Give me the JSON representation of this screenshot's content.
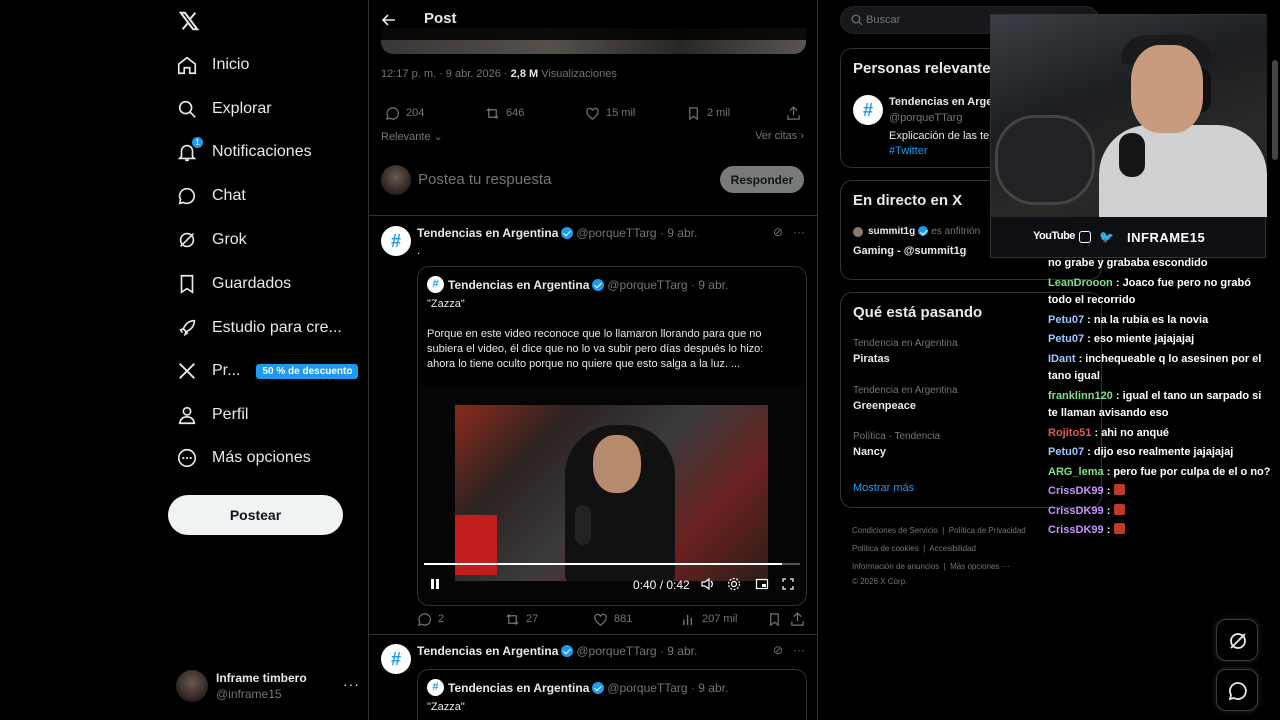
{
  "nav": {
    "items": [
      {
        "label": "Inicio",
        "icon": "home-icon"
      },
      {
        "label": "Explorar",
        "icon": "search-icon"
      },
      {
        "label": "Notificaciones",
        "icon": "bell-icon",
        "badge": "1"
      },
      {
        "label": "Chat",
        "icon": "chat-icon"
      },
      {
        "label": "Grok",
        "icon": "grok-icon"
      },
      {
        "label": "Guardados",
        "icon": "bookmark-icon"
      },
      {
        "label": "Estudio para cre...",
        "icon": "rocket-icon"
      },
      {
        "label": "Pr...",
        "icon": "x-icon",
        "promo": "50 % de descuento"
      },
      {
        "label": "Perfil",
        "icon": "person-icon"
      },
      {
        "label": "Más opciones",
        "icon": "more-circle-icon"
      }
    ],
    "post_button": "Postear",
    "account": {
      "name": "Inframe timbero",
      "handle": "@inframe15",
      "more": "···"
    }
  },
  "main": {
    "title": "Post",
    "post_meta": {
      "time": "12:17 p. m. · 9 abr. 2026 · ",
      "views": "2,8 M",
      "views_label": " Visualizaciones"
    },
    "post_stats": {
      "replies": "204",
      "reposts": "646",
      "likes": "15 mil",
      "bookmarks": "2 mil"
    },
    "sort_label": "Relevante",
    "view_quotes": "Ver citas",
    "reply_placeholder": "Postea tu respuesta",
    "reply_button": "Responder",
    "tweets": [
      {
        "name": "Tendencias en Argentina",
        "handle": "@porqueTTarg · 9 abr.",
        "text": ".",
        "quote": {
          "name": "Tendencias en Argentina",
          "handle": "@porqueTTarg · 9 abr.",
          "title": "\"Zazza\"",
          "body": "Porque en este video reconoce que lo llamaron llorando para que no subiera el video, él dice que no lo va subir pero días después lo hizo: ahora lo tiene oculto porque no quiere que esto salga a la luz.  ...",
          "video_time": "0:40 / 0:42",
          "video_progress": 0.952
        },
        "stats": {
          "replies": "2",
          "reposts": "27",
          "likes": "881",
          "views": "207 mil"
        }
      },
      {
        "name": "Tendencias en Argentina",
        "handle": "@porqueTTarg · 9 abr.",
        "quote": {
          "name": "Tendencias en Argentina",
          "handle": "@porqueTTarg · 9 abr.",
          "title": "\"Zazza\""
        }
      }
    ]
  },
  "right": {
    "search_placeholder": "Buscar",
    "people": {
      "title": "Personas relevantes",
      "name": "Tendencias en Argentina",
      "handle": "@porqueTTarg",
      "bio": "Explicación de las te",
      "tag": "#Twitter"
    },
    "live": {
      "title": "En directo en X",
      "host": "summit1g",
      "host_role": "es anfitrión",
      "stream": "Gaming - @summit1g"
    },
    "trends": {
      "title": "Qué está pasando",
      "items": [
        {
          "context": "Tendencia en Argentina",
          "name": "Piratas"
        },
        {
          "context": "Tendencia en Argentina",
          "name": "Greenpeace"
        },
        {
          "context": "Política · Tendencia",
          "name": "Nancy"
        }
      ],
      "show_more": "Mostrar más"
    },
    "footer": {
      "l1a": "Condiciones de Servicio",
      "l1b": "Política de Privacidad",
      "l2a": "Política de cookies",
      "l2b": "Accesibilidad",
      "l3a": "Información de anuncios",
      "l3b": "Más opciones ···",
      "copyright": "© 2026 X Corp."
    }
  },
  "stream_overlay": {
    "social": {
      "youtube": "YouTube",
      "brand": "INFRAME15"
    },
    "chat": [
      {
        "user": "",
        "color": "#ffffff",
        "text": "no grabe y grababa escondido"
      },
      {
        "user": "LeanDrooon",
        "color": "#7ee08a",
        "text": ": Joaco fue pero no grabó todo el recorrido"
      },
      {
        "user": "Petu07",
        "color": "#9fc5ff",
        "text": ": na la rubia es la novia"
      },
      {
        "user": "Petu07",
        "color": "#9fc5ff",
        "text": ": eso miente jajajajaj"
      },
      {
        "user": "IDant",
        "color": "#9fc5ff",
        "text": ": inchequeable q lo asesinen por el tano igual"
      },
      {
        "user": "franklinn120",
        "color": "#7ee08a",
        "text": ": igual el tano un sarpado si te llaman avisando eso"
      },
      {
        "user": "Rojito51",
        "color": "#e05a5a",
        "text": ": ahi no anqué"
      },
      {
        "user": "Petu07",
        "color": "#9fc5ff",
        "text": ": dijo eso realmente jajajajaj"
      },
      {
        "user": "ARG_lema",
        "color": "#7ee08a",
        "text": ": pero fue por culpa de el o no?"
      },
      {
        "user": "CrissDK99",
        "color": "#c792ff",
        "text": ":"
      },
      {
        "user": "CrissDK99",
        "color": "#c792ff",
        "text": ":"
      },
      {
        "user": "CrissDK99",
        "color": "#c792ff",
        "text": ":"
      }
    ]
  },
  "colors": {
    "accent": "#1d9bf0",
    "background": "#000000",
    "border": "#2f3336",
    "muted": "#71767b"
  }
}
